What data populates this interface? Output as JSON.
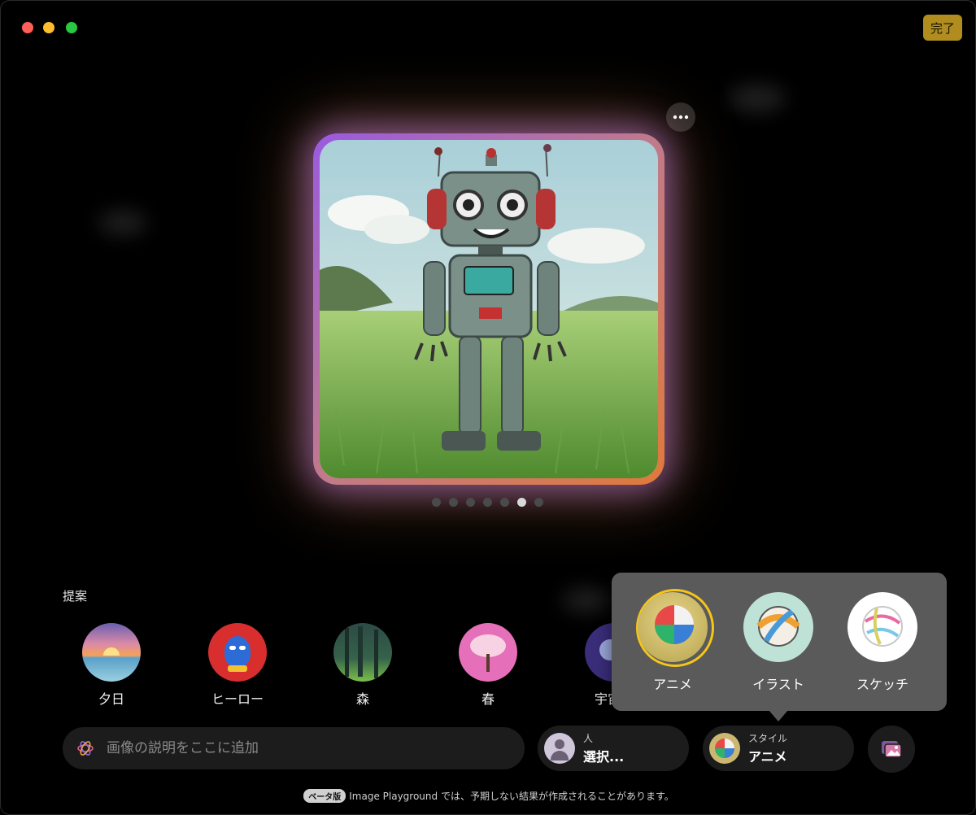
{
  "window": {
    "done_label": "完了"
  },
  "gallery": {
    "page_count": 7,
    "active_index": 5
  },
  "suggestions": {
    "title": "提案",
    "items": [
      {
        "label": "夕日",
        "icon": "sunset-icon"
      },
      {
        "label": "ヒーロー",
        "icon": "hero-mask-icon"
      },
      {
        "label": "森",
        "icon": "forest-icon"
      },
      {
        "label": "春",
        "icon": "blossom-tree-icon"
      },
      {
        "label": "宇宙飛",
        "icon": "astronaut-icon"
      }
    ]
  },
  "style_popover": {
    "options": [
      {
        "label": "アニメ",
        "selected": true
      },
      {
        "label": "イラスト",
        "selected": false
      },
      {
        "label": "スケッチ",
        "selected": false
      }
    ],
    "selected_ring_color": "#f5c518"
  },
  "prompt": {
    "placeholder": "画像の説明をここに追加"
  },
  "person_pill": {
    "caption": "人",
    "value": "選択..."
  },
  "style_pill": {
    "caption": "スタイル",
    "value": "アニメ"
  },
  "footer": {
    "badge": "ベータ版",
    "text": "Image Playground では、予期しない結果が作成されることがあります。"
  },
  "colors": {
    "accent": "#b08d1e",
    "glow_purple": "#9a5ae0",
    "glow_orange": "#e07a3a"
  }
}
